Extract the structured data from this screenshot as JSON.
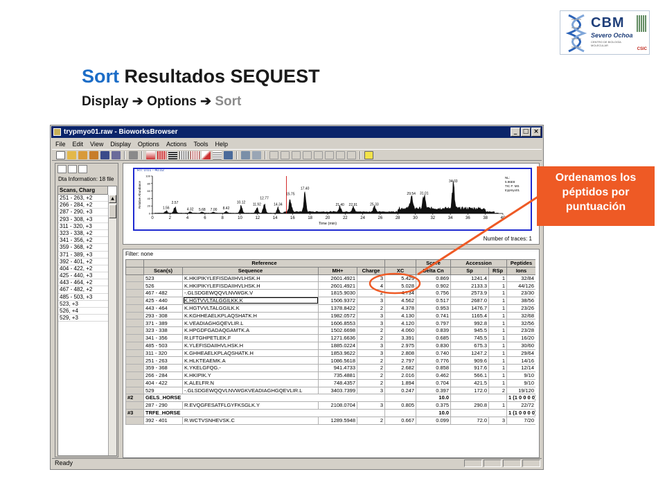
{
  "slide": {
    "title_accent": "Sort",
    "title_rest": " Resultados SEQUEST",
    "subtitle_a": "Display ",
    "subtitle_b": " Options ",
    "subtitle_accent": " Sort",
    "arrow_glyph": "➔",
    "callout_lines": [
      "Ordenamos los",
      "péptidos por",
      "puntuación"
    ]
  },
  "logo": {
    "name": "CBM",
    "sub": "Severo Ochoa",
    "small": "CENTRO DE BIOLOGÍA MOLECULAR",
    "csic": "CSIC"
  },
  "window": {
    "title": "trypmyo01.raw - BioworksBrowser",
    "menus": [
      "File",
      "Edit",
      "View",
      "Display",
      "Options",
      "Actions",
      "Tools",
      "Help"
    ],
    "status": "Ready"
  },
  "left_panel": {
    "info": "Dta Information: 18 file",
    "header": "Scans, Charg",
    "items": [
      "251 - 263, +2",
      "266 - 284, +2",
      "287 - 290, +3",
      "293 - 308, +3",
      "311 - 320, +3",
      "323 - 338, +2",
      "341 - 356, +2",
      "359 - 368, +2",
      "371 - 389, +3",
      "392 - 401, +2",
      "404 - 422, +2",
      "425 - 440, +3",
      "443 - 464, +2",
      "467 - 482, +2",
      "485 - 503, +3",
      "523, +3",
      "526, +4",
      "529, +3"
    ]
  },
  "chromatogram": {
    "rt_label": "RT: 0.01 - 40.02",
    "y_axis_label": "Relative Abundance",
    "x_axis_label": "Time (min)",
    "legend": [
      "NL:",
      "5.96E8",
      "TIC F: MS",
      "trypmyo01"
    ],
    "peaks": [
      {
        "t": 1.56,
        "label": "1.56",
        "h": 8
      },
      {
        "t": 2.57,
        "label": "2.57",
        "h": 22
      },
      {
        "t": 4.32,
        "label": "4.32",
        "h": 5
      },
      {
        "t": 5.68,
        "label": "5.68",
        "h": 4
      },
      {
        "t": 7.0,
        "label": "7.00",
        "h": 4
      },
      {
        "t": 8.42,
        "label": "8.42",
        "h": 7
      },
      {
        "t": 10.12,
        "label": "10.12",
        "h": 23
      },
      {
        "t": 11.92,
        "label": "11.92",
        "h": 18
      },
      {
        "t": 12.77,
        "label": "12.77",
        "h": 34
      },
      {
        "t": 14.34,
        "label": "14.34",
        "h": 18
      },
      {
        "t": 15.75,
        "label": "15.75",
        "h": 45
      },
      {
        "t": 17.4,
        "label": "17.40",
        "h": 60
      },
      {
        "t": 21.4,
        "label": "21.40",
        "h": 17
      },
      {
        "t": 22.91,
        "label": "22.91",
        "h": 17
      },
      {
        "t": 25.33,
        "label": "25.33",
        "h": 18
      },
      {
        "t": 29.54,
        "label": "29.54",
        "h": 46
      },
      {
        "t": 31.01,
        "label": "31.01",
        "h": 47
      },
      {
        "t": 34.33,
        "label": "34.33",
        "h": 80
      }
    ],
    "x_ticks": [
      0,
      2,
      4,
      6,
      8,
      10,
      12,
      14,
      16,
      18,
      20,
      22,
      24,
      26,
      28,
      30,
      32,
      34,
      36,
      38,
      40
    ],
    "y_ticks": [
      0,
      20,
      40,
      60,
      80,
      100
    ],
    "traces": "Number of traces: 1"
  },
  "table": {
    "filter": "Filter: none",
    "group_headers": {
      "reference": "Reference",
      "score": "Score",
      "accession": "Accession",
      "peptides": "Peptides"
    },
    "columns": [
      "Scan(s)",
      "Sequence",
      "MH+",
      "Charge",
      "XC",
      "Delta Cn",
      "Sp",
      "RSp",
      "Ions"
    ],
    "rows": [
      {
        "type": "pep",
        "scan": "523",
        "seq": "K.HKIPIKYLEFISDAIIHVLHSK.H",
        "mh": "2601.4921",
        "z": "3",
        "xc": "5.429",
        "dcn": "0.869",
        "sp": "1241.4",
        "rsp": "1",
        "ions": "32/84"
      },
      {
        "type": "pep",
        "scan": "526",
        "seq": "K.HKIPIKYLEFISDAIIHVLHSK.H",
        "mh": "2601.4921",
        "z": "4",
        "xc": "5.028",
        "dcn": "0.902",
        "sp": "2133.3",
        "rsp": "1",
        "ions": "44/126"
      },
      {
        "type": "pep",
        "scan": "467 - 482",
        "seq": "-.GLSDGEWQQVLNVWGK.V",
        "mh": "1815.9030",
        "z": "2",
        "xc": "4.734",
        "dcn": "0.756",
        "sp": "2573.9",
        "rsp": "1",
        "ions": "23/30"
      },
      {
        "type": "pep",
        "scan": "425 - 440",
        "seq": "K.HGTVVLTALGGILKK.K",
        "mh": "1506.9372",
        "z": "3",
        "xc": "4.562",
        "dcn": "0.517",
        "sp": "2687.0",
        "rsp": "1",
        "ions": "38/56",
        "sel": true
      },
      {
        "type": "pep",
        "scan": "443 - 464",
        "seq": "K.HGTVVLTALGGILK.K",
        "mh": "1378.8422",
        "z": "2",
        "xc": "4.378",
        "dcn": "0.953",
        "sp": "1476.7",
        "rsp": "1",
        "ions": "23/26"
      },
      {
        "type": "pep",
        "scan": "293 - 308",
        "seq": "K.KGHHEAELKPLAQSHATK.H",
        "mh": "1982.0572",
        "z": "3",
        "xc": "4.130",
        "dcn": "0.741",
        "sp": "1165.4",
        "rsp": "1",
        "ions": "32/68"
      },
      {
        "type": "pep",
        "scan": "371 - 389",
        "seq": "K.VEADIAGHGQEVLIR.L",
        "mh": "1606.8553",
        "z": "3",
        "xc": "4.120",
        "dcn": "0.797",
        "sp": "992.8",
        "rsp": "1",
        "ions": "32/56"
      },
      {
        "type": "pep",
        "scan": "323 - 338",
        "seq": "K.HPGDFGADAQGAMTK.A",
        "mh": "1502.6698",
        "z": "2",
        "xc": "4.060",
        "dcn": "0.839",
        "sp": "945.5",
        "rsp": "1",
        "ions": "23/28"
      },
      {
        "type": "pep",
        "scan": "341 - 356",
        "seq": "R.LFTGHPETLEK.F",
        "mh": "1271.6636",
        "z": "2",
        "xc": "3.391",
        "dcn": "0.685",
        "sp": "745.5",
        "rsp": "1",
        "ions": "16/20"
      },
      {
        "type": "pep",
        "scan": "485 - 503",
        "seq": "K.YLEFISDAIIHVLHSK.H",
        "mh": "1885.0224",
        "z": "3",
        "xc": "2.975",
        "dcn": "0.830",
        "sp": "675.3",
        "rsp": "1",
        "ions": "30/60"
      },
      {
        "type": "pep",
        "scan": "311 - 320",
        "seq": "K.GHHEAELKPLAQSHATK.H",
        "mh": "1853.9622",
        "z": "3",
        "xc": "2.808",
        "dcn": "0.740",
        "sp": "1247.2",
        "rsp": "1",
        "ions": "29/64"
      },
      {
        "type": "pep",
        "scan": "251 - 263",
        "seq": "K.HLKTEAEMK.A",
        "mh": "1086.5618",
        "z": "2",
        "xc": "2.797",
        "dcn": "0.776",
        "sp": "909.6",
        "rsp": "1",
        "ions": "14/16"
      },
      {
        "type": "pep",
        "scan": "359 - 368",
        "seq": "K.YKELGFQG.-",
        "mh": "941.4733",
        "z": "2",
        "xc": "2.682",
        "dcn": "0.858",
        "sp": "917.6",
        "rsp": "1",
        "ions": "12/14"
      },
      {
        "type": "pep",
        "scan": "266 - 284",
        "seq": "K.HKIPIK.Y",
        "mh": "735.4881",
        "z": "2",
        "xc": "2.016",
        "dcn": "0.462",
        "sp": "566.1",
        "rsp": "1",
        "ions": "9/10"
      },
      {
        "type": "pep",
        "scan": "404 - 422",
        "seq": "K.ALELFR.N",
        "mh": "748.4357",
        "z": "2",
        "xc": "1.894",
        "dcn": "0.704",
        "sp": "421.5",
        "rsp": "1",
        "ions": "9/10"
      },
      {
        "type": "pep",
        "scan": "529",
        "seq": "-.GLSDGEWQQVLNVWGKVEADIAGHGQEVLIR.L",
        "mh": "3403.7399",
        "z": "3",
        "xc": "0.247",
        "dcn": "0.397",
        "sp": "172.0",
        "rsp": "2",
        "ions": "19/120"
      },
      {
        "type": "grp",
        "idx": "#2",
        "name": "GELS_HORSE",
        "score": "10.0",
        "acc": "1 (1 0 0 0 0)"
      },
      {
        "type": "pep",
        "scan": "287 - 290",
        "seq": "R.EVQGFESATFLGYFKSGLK.Y",
        "mh": "2108.0704",
        "z": "3",
        "xc": "0.805",
        "dcn": "0.375",
        "sp": "290.8",
        "rsp": "1",
        "ions": "22/72"
      },
      {
        "type": "grp",
        "idx": "#3",
        "name": "TRFE_HORSE",
        "score": "10.0",
        "acc": "1 (1 0 0 0 0)"
      },
      {
        "type": "pep",
        "scan": "392 - 401",
        "seq": "R.WCTVSNHEVSK.C",
        "mh": "1289.5948",
        "z": "2",
        "xc": "0.667",
        "dcn": "0.099",
        "sp": "72.0",
        "rsp": "3",
        "ions": "7/20"
      }
    ]
  },
  "colors": {
    "accent_blue": "#1c6dc7",
    "callout_orange": "#ee5a25",
    "titlebar_navy": "#0a246a",
    "chromo_border": "#1e2ad0"
  }
}
